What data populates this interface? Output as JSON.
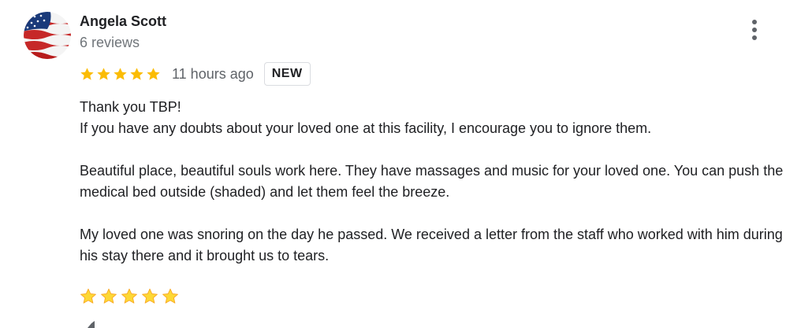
{
  "author": {
    "name": "Angela Scott",
    "review_count": "6 reviews",
    "avatar_icon": "american-flag-avatar"
  },
  "rating": {
    "stars": 5,
    "max_stars": 5,
    "star_color": "#fbbc04",
    "time_ago": "11 hours ago",
    "badge": "NEW"
  },
  "review": {
    "line1": "Thank you TBP!",
    "line2": "If you have any doubts about your loved one at this facility, I encourage you to ignore them.",
    "paragraph2": "Beautiful place, beautiful souls work here. They have massages and music for your loved one. You can push the medical bed outside (shaded) and let them feel the breeze.",
    "paragraph3": "My loved one was snoring on the day he passed. We received a letter from the staff who worked with him during his stay there and it brought us to tears."
  },
  "emoji_stars": {
    "count": 5,
    "icon": "star-emoji",
    "color": "#fdd835"
  },
  "menu": {
    "icon": "more-vert-icon"
  }
}
